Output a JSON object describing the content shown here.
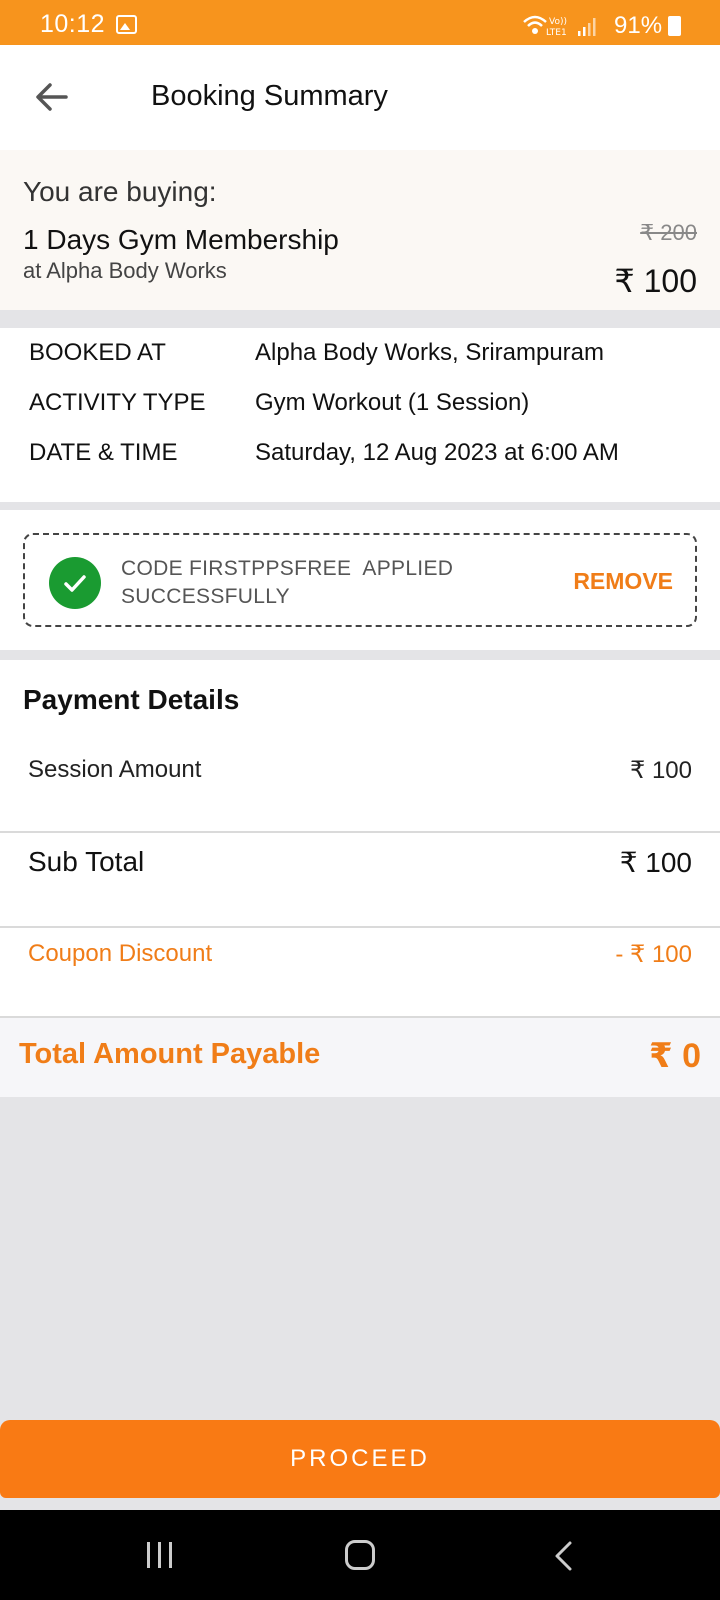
{
  "status_bar": {
    "time": "10:12",
    "network_label": "Vo)) LTE1",
    "battery": "91%"
  },
  "header": {
    "title": "Booking Summary"
  },
  "purchase": {
    "label": "You are buying:",
    "plan": "1 Days Gym Membership",
    "venue": "at Alpha Body Works",
    "original_price": "₹ 200",
    "price": "₹ 100"
  },
  "booking_details": [
    {
      "key": "BOOKED AT",
      "value": "Alpha Body Works, Srirampuram"
    },
    {
      "key": "ACTIVITY TYPE",
      "value": "Gym Workout (1 Session)"
    },
    {
      "key": "DATE & TIME",
      "value": "Saturday, 12 Aug 2023 at 6:00 AM"
    }
  ],
  "coupon": {
    "message_line1": "CODE FIRSTPPSFREE  APPLIED",
    "message_line2": "SUCCESSFULLY",
    "remove_label": "REMOVE"
  },
  "payment": {
    "heading": "Payment Details",
    "session_amount_label": "Session Amount",
    "session_amount": "₹ 100",
    "subtotal_label": "Sub Total",
    "subtotal": "₹ 100",
    "discount_label": "Coupon Discount",
    "discount": "- ₹ 100",
    "total_label": "Total Amount Payable",
    "total": "₹ 0"
  },
  "actions": {
    "proceed_label": "PROCEED"
  },
  "colors": {
    "accent": "#f7941d",
    "button": "#f97a14",
    "success": "#1a9b31"
  }
}
